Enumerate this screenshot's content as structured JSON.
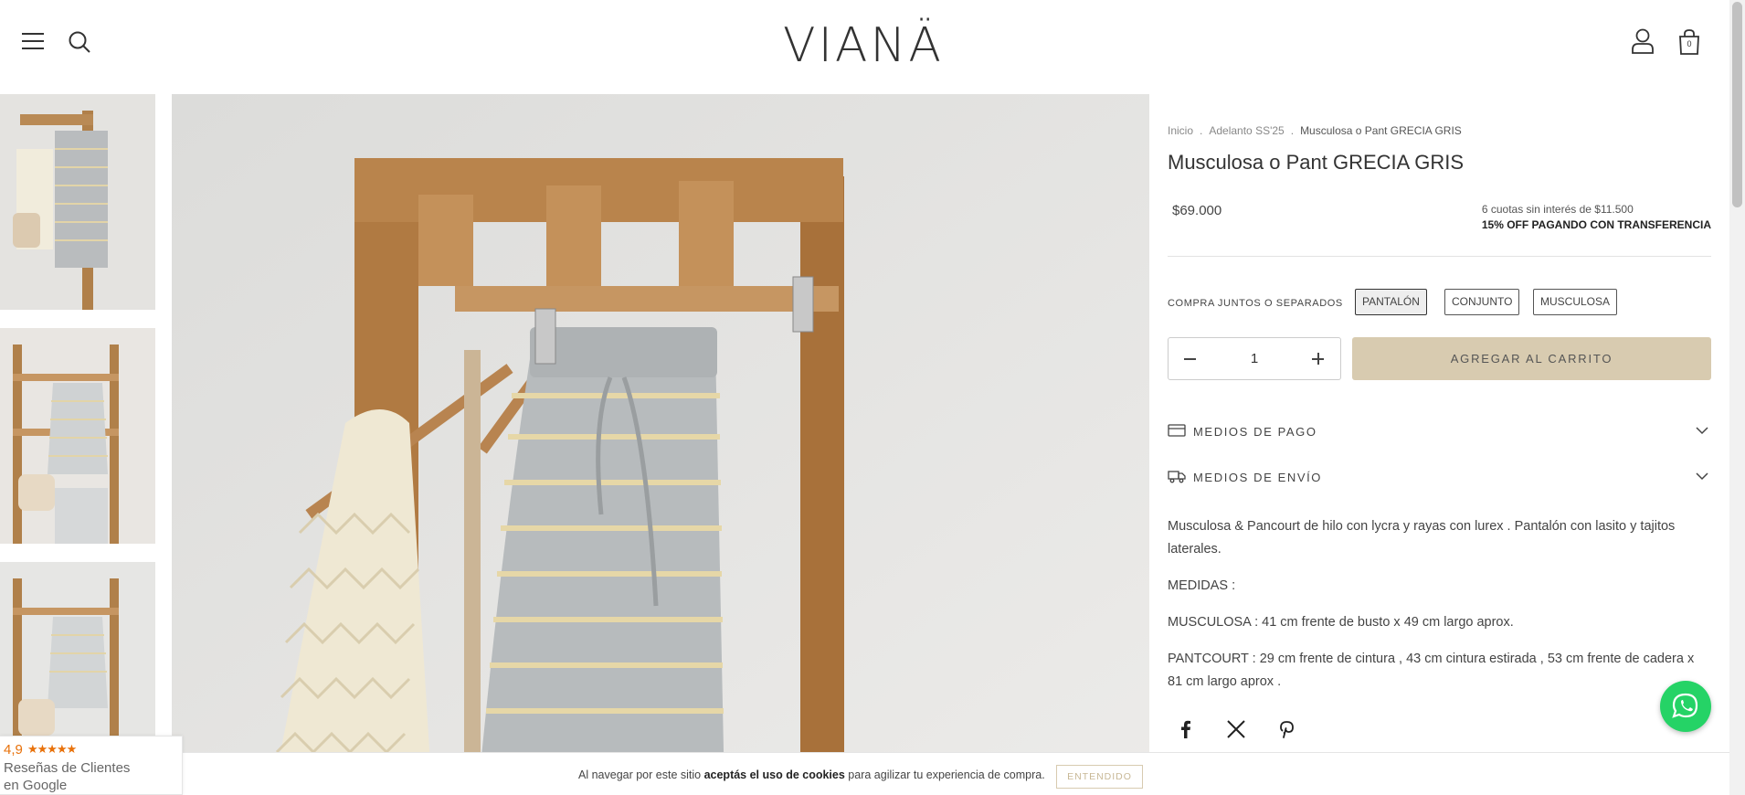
{
  "header": {
    "logo": "VIANÄ",
    "cart_count": "0"
  },
  "breadcrumb": {
    "items": [
      "Inicio",
      "Adelanto SS'25",
      "Musculosa o Pant GRECIA GRIS"
    ],
    "separator": "."
  },
  "product": {
    "title": "Musculosa o Pant GRECIA GRIS",
    "price": "$69.000",
    "installments": "6 cuotas sin interés de $11.500",
    "transfer_promo": "15% OFF PAGANDO CON TRANSFERENCIA",
    "variant_label": "COMPRA JUNTOS O SEPARADOS",
    "variants": [
      "PANTALÓN",
      "CONJUNTO",
      "MUSCULOSA"
    ],
    "selected_variant": "PANTALÓN",
    "quantity": "1",
    "add_to_cart": "AGREGAR AL CARRITO",
    "accordions": [
      {
        "label": "MEDIOS DE PAGO",
        "icon": "credit-card-icon"
      },
      {
        "label": "MEDIOS DE ENVÍO",
        "icon": "truck-icon"
      }
    ],
    "description": [
      "Musculosa & Pancourt de hilo con lycra y rayas con lurex . Pantalón con lasito y tajitos laterales.",
      "MEDIDAS :",
      "MUSCULOSA :  41 cm frente de busto x 49 cm largo aprox.",
      "PANTCOURT : 29 cm frente de cintura , 43 cm cintura estirada , 53 cm frente de cadera x 81 cm largo aprox ."
    ],
    "share": [
      "facebook-icon",
      "x-icon",
      "pinterest-icon"
    ]
  },
  "cookie": {
    "text_before": "Al navegar por este sitio ",
    "text_bold": "aceptás el uso de cookies",
    "text_after": " para agilizar tu experiencia de compra.",
    "button": "ENTENDIDO"
  },
  "reviews": {
    "rating": "4,9",
    "stars": "★★★★★",
    "line1": "Reseñas de Clientes",
    "line2": "en Google"
  },
  "colors": {
    "accent": "#d8cbb0",
    "whatsapp": "#25d366",
    "rating": "#e8710a"
  }
}
